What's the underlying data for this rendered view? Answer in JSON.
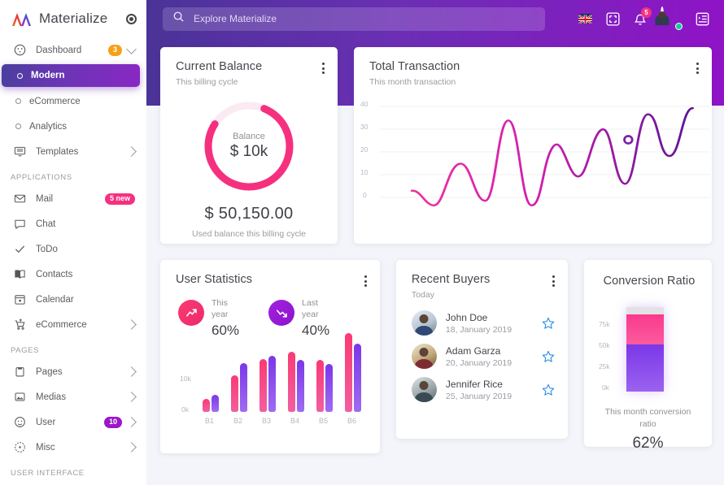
{
  "brand": {
    "name": "Materialize",
    "logo_icon": "materialize-logo",
    "pin_icon": "radio-dot-icon"
  },
  "sidebar": {
    "items": [
      {
        "label": "Dashboard",
        "icon": "dashboard-icon",
        "badge": "3",
        "badge_color": "#f6a117",
        "chevron": "chevron-down-icon"
      },
      {
        "label": "Modern",
        "icon": "circle-dot-icon",
        "active": true
      },
      {
        "label": "eCommerce",
        "icon": "circle-dot-icon"
      },
      {
        "label": "Analytics",
        "icon": "circle-dot-icon"
      },
      {
        "label": "Templates",
        "icon": "monitor-icon",
        "chevron": "chevron-right-icon"
      }
    ],
    "section_applications": "APPLICATIONS",
    "apps": [
      {
        "label": "Mail",
        "icon": "mail-icon",
        "badge": "5 new",
        "badge_color": "#f5317f"
      },
      {
        "label": "Chat",
        "icon": "chat-icon"
      },
      {
        "label": "ToDo",
        "icon": "check-icon"
      },
      {
        "label": "Contacts",
        "icon": "book-icon"
      },
      {
        "label": "Calendar",
        "icon": "calendar-icon"
      },
      {
        "label": "eCommerce",
        "icon": "cart-icon",
        "chevron": "chevron-right-icon"
      }
    ],
    "section_pages": "PAGES",
    "pages": [
      {
        "label": "Pages",
        "icon": "clipboard-icon",
        "chevron": "chevron-right-icon"
      },
      {
        "label": "Medias",
        "icon": "image-icon",
        "chevron": "chevron-right-icon"
      },
      {
        "label": "User",
        "icon": "user-icon",
        "badge": "10",
        "badge_color": "#9b16c9",
        "chevron": "chevron-right-icon"
      },
      {
        "label": "Misc",
        "icon": "misc-icon",
        "chevron": "chevron-right-icon"
      }
    ],
    "section_user_interface": "USER INTERFACE"
  },
  "header": {
    "search_placeholder": "Explore Materialize",
    "search_value": "",
    "search_icon": "search-icon",
    "flag_icon": "uk-flag-icon",
    "fullscreen_icon": "fullscreen-icon",
    "bell_icon": "bell-icon",
    "bell_badge": "5",
    "avatar_icon": "user-avatar",
    "menu_icon": "list-toggle-icon",
    "gradient_from": "#4a3397",
    "gradient_to": "#9013c7"
  },
  "cards": {
    "balance": {
      "title": "Current Balance",
      "subtitle": "This billing cycle",
      "donut_label": "Balance",
      "donut_value": "$ 10k",
      "amount": "$ 50,150.00",
      "footer": "Used balance this billing cycle",
      "accent": "#f5317f",
      "progress_pct": 78
    },
    "transaction": {
      "title": "Total Transaction",
      "subtitle": "This month transaction"
    },
    "userstats": {
      "title": "User Statistics",
      "stats": [
        {
          "when_line1": "This",
          "when_line2": "year",
          "pct": "60%",
          "icon": "trending-up-icon",
          "color": "#fb3a72"
        },
        {
          "when_line1": "Last",
          "when_line2": "year",
          "pct": "40%",
          "icon": "trending-down-icon",
          "color": "#a122e0"
        }
      ]
    },
    "buyers": {
      "title": "Recent Buyers",
      "subtitle": "Today",
      "rows": [
        {
          "name": "John Doe",
          "date": "18, January 2019",
          "star_icon": "star-outline-icon"
        },
        {
          "name": "Adam Garza",
          "date": "20, January 2019",
          "star_icon": "star-outline-icon"
        },
        {
          "name": "Jennifer Rice",
          "date": "25, January 2019",
          "star_icon": "star-outline-icon"
        }
      ]
    },
    "conversion": {
      "title": "Conversion Ratio",
      "footer": "This month conversion ratio",
      "pct": "62%"
    }
  },
  "chart_data": [
    {
      "type": "line",
      "title": "Total Transaction",
      "subtitle": "This month transaction",
      "xlabel": "",
      "ylabel": "",
      "ylim": [
        0,
        47
      ],
      "yticks": [
        0,
        10,
        20,
        30,
        40
      ],
      "grid": true,
      "legend": "none",
      "marker_point": {
        "x": 12,
        "y": 34
      },
      "series": [
        {
          "name": "Transactions",
          "color_from": "#f02fa0",
          "color_to": "#6a1b9a",
          "x": [
            0,
            1,
            2,
            3,
            4,
            5,
            6,
            7,
            8,
            9,
            10,
            11,
            12,
            13,
            14,
            15,
            16,
            17
          ],
          "values": [
            9,
            8.5,
            3,
            4,
            19,
            6,
            6.5,
            44,
            10,
            4,
            20,
            34,
            34,
            19,
            22,
            46,
            29,
            47
          ]
        }
      ]
    },
    {
      "type": "bar",
      "title": "User Statistics",
      "categories": [
        "B1",
        "B2",
        "B3",
        "B4",
        "B5",
        "B6"
      ],
      "yticks": [
        "0k",
        "10k"
      ],
      "ylim": [
        0,
        16000
      ],
      "grid": false,
      "series": [
        {
          "name": "This year",
          "color": "#fa3a74",
          "values": [
            2300,
            7000,
            10200,
            11600,
            10100,
            15300
          ]
        },
        {
          "name": "Last year",
          "color": "#7b37e8",
          "values": [
            3100,
            9400,
            10900,
            10000,
            9300,
            13200
          ]
        }
      ]
    },
    {
      "type": "bar",
      "title": "Conversion Ratio",
      "subtitle": "This month conversion ratio",
      "categories": [
        "Conversion"
      ],
      "yticks": [
        "0k",
        "25k",
        "50k",
        "75k"
      ],
      "ylim": [
        0,
        90000
      ],
      "stacked": true,
      "grid": false,
      "series": [
        {
          "name": "Converted",
          "color": "#7b37e8",
          "values": [
            50000
          ]
        },
        {
          "name": "Pending",
          "color": "#fa3a8c",
          "values": [
            32000
          ]
        },
        {
          "name": "Remaining",
          "color": "#e2e2e6",
          "values": [
            8000
          ]
        }
      ],
      "value_label": "62%"
    },
    {
      "type": "pie",
      "title": "Current Balance",
      "subtitle": "This billing cycle",
      "center_label": "Balance",
      "center_value": "$ 10k",
      "values": [
        78,
        22
      ],
      "labels": [
        "Used",
        "Remaining"
      ],
      "colors": [
        "#f5317f",
        "#faeaf2"
      ]
    }
  ]
}
